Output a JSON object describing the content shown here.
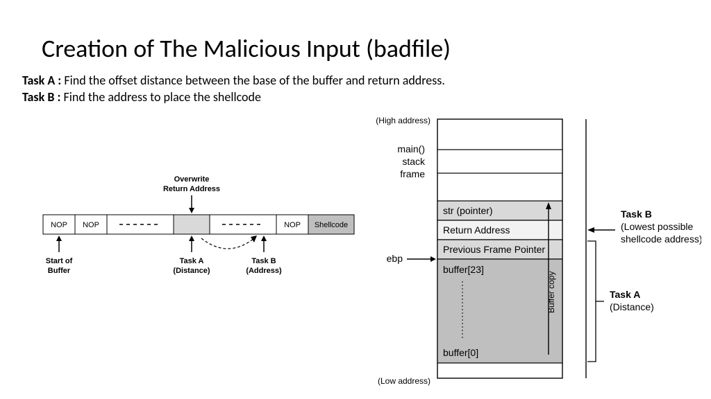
{
  "title": "Creation of The Malicious Input (badfile)",
  "taskA_label": "Task A :",
  "taskA_text": " Find the offset distance between the base of the buffer and return address.",
  "taskB_label": "Task B :",
  "taskB_text": " Find the address to place the shellcode",
  "buffer": {
    "nop1": "NOP",
    "nop2": "NOP",
    "nop3": "NOP",
    "shellcode": "Shellcode",
    "overwrite_ra_top": "Overwrite",
    "overwrite_ra_bot": "Return Address",
    "start_buf_top": "Start of",
    "start_buf_bot": "Buffer",
    "taska_top": "Task A",
    "taska_bot": "(Distance)",
    "taskb_top": "Task B",
    "taskb_bot": "(Address)"
  },
  "stack": {
    "high": "(High address)",
    "low": "(Low address)",
    "main1": "main()",
    "main2": "stack",
    "main3": "frame",
    "str": "str (pointer)",
    "ret": "Return Address",
    "pfp": "Previous Frame Pointer",
    "ebp": "ebp",
    "buf23": "buffer[23]",
    "buf0": "buffer[0]",
    "bufcopy": "Buffer copy",
    "taskB_label": "Task B",
    "taskB_sub1": "(Lowest possible",
    "taskB_sub2": "shellcode address)",
    "taskA_label": "Task A",
    "taskA_sub": "(Distance)"
  }
}
